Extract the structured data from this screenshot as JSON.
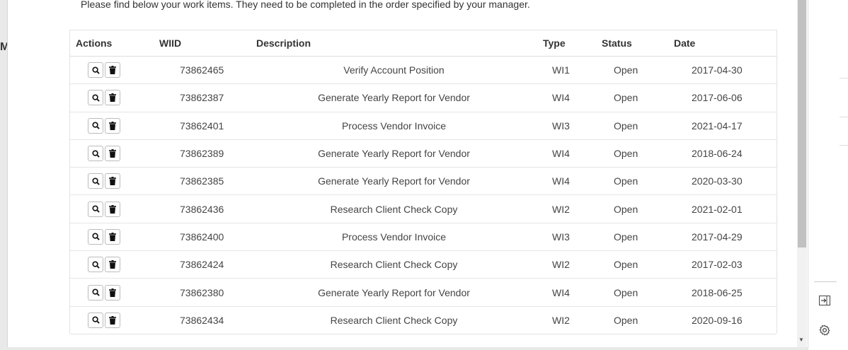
{
  "background": {
    "stub_text": "M"
  },
  "modal": {
    "intro": "Please find below your work items. They need to be completed in the order specified by your manager."
  },
  "table": {
    "headers": {
      "actions": "Actions",
      "wiid": "WIID",
      "description": "Description",
      "type": "Type",
      "status": "Status",
      "date": "Date"
    },
    "rows": [
      {
        "wiid": "73862465",
        "description": "Verify Account Position",
        "type": "WI1",
        "status": "Open",
        "date": "2017-04-30"
      },
      {
        "wiid": "73862387",
        "description": "Generate Yearly Report for Vendor",
        "type": "WI4",
        "status": "Open",
        "date": "2017-06-06"
      },
      {
        "wiid": "73862401",
        "description": "Process Vendor Invoice",
        "type": "WI3",
        "status": "Open",
        "date": "2021-04-17"
      },
      {
        "wiid": "73862389",
        "description": "Generate Yearly Report for Vendor",
        "type": "WI4",
        "status": "Open",
        "date": "2018-06-24"
      },
      {
        "wiid": "73862385",
        "description": "Generate Yearly Report for Vendor",
        "type": "WI4",
        "status": "Open",
        "date": "2020-03-30"
      },
      {
        "wiid": "73862436",
        "description": "Research Client Check Copy",
        "type": "WI2",
        "status": "Open",
        "date": "2021-02-01"
      },
      {
        "wiid": "73862400",
        "description": "Process Vendor Invoice",
        "type": "WI3",
        "status": "Open",
        "date": "2017-04-29"
      },
      {
        "wiid": "73862424",
        "description": "Research Client Check Copy",
        "type": "WI2",
        "status": "Open",
        "date": "2017-02-03"
      },
      {
        "wiid": "73862380",
        "description": "Generate Yearly Report for Vendor",
        "type": "WI4",
        "status": "Open",
        "date": "2018-06-25"
      },
      {
        "wiid": "73862434",
        "description": "Research Client Check Copy",
        "type": "WI2",
        "status": "Open",
        "date": "2020-09-16"
      }
    ]
  },
  "icons": {
    "view": "search-icon",
    "delete": "trash-icon",
    "panel_toggle": "sidebar-collapse-icon",
    "settings": "gear-icon"
  }
}
